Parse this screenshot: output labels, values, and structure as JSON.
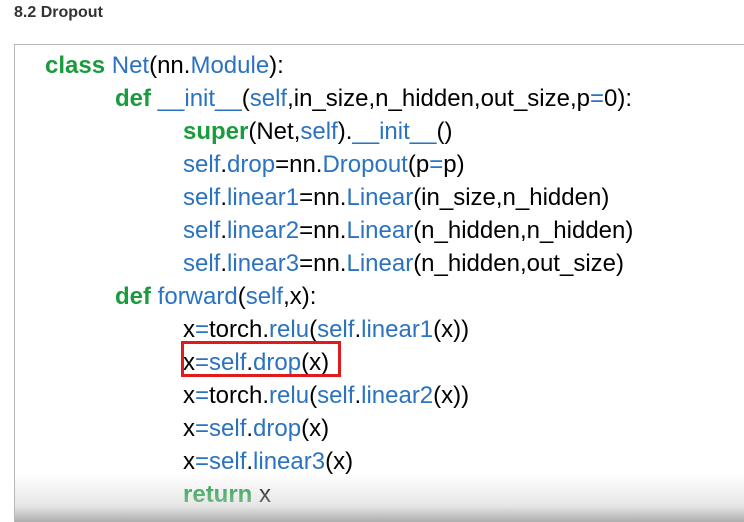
{
  "heading": "8.2 Dropout",
  "colors": {
    "keyword": "#1a9c3e",
    "name": "#2b73c0",
    "plain": "#000000",
    "highlight_box": "#e01b1b",
    "card_border": "#b8b8b8"
  },
  "code": {
    "language": "python",
    "highlighted_line": 10,
    "lines": [
      {
        "indent": 0,
        "tokens": [
          {
            "t": "class ",
            "c": "kw"
          },
          {
            "t": "Net",
            "c": "bl"
          },
          {
            "t": "(nn.",
            "c": "bk"
          },
          {
            "t": "Module",
            "c": "bl"
          },
          {
            "t": "):",
            "c": "bk"
          }
        ]
      },
      {
        "indent": 1,
        "tokens": [
          {
            "t": "def ",
            "c": "kw"
          },
          {
            "t": "__init__",
            "c": "bl"
          },
          {
            "t": "(",
            "c": "bk"
          },
          {
            "t": "self",
            "c": "bl"
          },
          {
            "t": ",in_size,n_hidden,out_size,p",
            "c": "bk"
          },
          {
            "t": "=",
            "c": "bl"
          },
          {
            "t": "0):",
            "c": "bk"
          }
        ]
      },
      {
        "indent": 2,
        "tokens": [
          {
            "t": "super",
            "c": "kw"
          },
          {
            "t": "(Net,",
            "c": "bk"
          },
          {
            "t": "self",
            "c": "bl"
          },
          {
            "t": ").",
            "c": "bk"
          },
          {
            "t": "__init__",
            "c": "bl"
          },
          {
            "t": "()",
            "c": "bk"
          }
        ]
      },
      {
        "indent": 2,
        "tokens": [
          {
            "t": "self",
            "c": "bl"
          },
          {
            "t": ".",
            "c": "bk"
          },
          {
            "t": "drop",
            "c": "bl"
          },
          {
            "t": "=nn.",
            "c": "bk"
          },
          {
            "t": "Dropout",
            "c": "bl"
          },
          {
            "t": "(p",
            "c": "bk"
          },
          {
            "t": "=",
            "c": "bl"
          },
          {
            "t": "p)",
            "c": "bk"
          }
        ]
      },
      {
        "indent": 2,
        "tokens": [
          {
            "t": "self",
            "c": "bl"
          },
          {
            "t": ".",
            "c": "bk"
          },
          {
            "t": "linear1",
            "c": "bl"
          },
          {
            "t": "=nn.",
            "c": "bk"
          },
          {
            "t": "Linear",
            "c": "bl"
          },
          {
            "t": "(in_size,n_hidden)",
            "c": "bk"
          }
        ]
      },
      {
        "indent": 2,
        "tokens": [
          {
            "t": "self",
            "c": "bl"
          },
          {
            "t": ".",
            "c": "bk"
          },
          {
            "t": "linear2",
            "c": "bl"
          },
          {
            "t": "=nn.",
            "c": "bk"
          },
          {
            "t": "Linear",
            "c": "bl"
          },
          {
            "t": "(n_hidden,n_hidden)",
            "c": "bk"
          }
        ]
      },
      {
        "indent": 2,
        "tokens": [
          {
            "t": "self",
            "c": "bl"
          },
          {
            "t": ".",
            "c": "bk"
          },
          {
            "t": "linear3",
            "c": "bl"
          },
          {
            "t": "=nn.",
            "c": "bk"
          },
          {
            "t": "Linear",
            "c": "bl"
          },
          {
            "t": "(n_hidden,out_size)",
            "c": "bk"
          }
        ]
      },
      {
        "indent": 1,
        "tokens": [
          {
            "t": "def ",
            "c": "kw"
          },
          {
            "t": "forward",
            "c": "bl"
          },
          {
            "t": "(",
            "c": "bk"
          },
          {
            "t": "self",
            "c": "bl"
          },
          {
            "t": ",x):",
            "c": "bk"
          }
        ]
      },
      {
        "indent": 2,
        "tokens": [
          {
            "t": "x",
            "c": "bk"
          },
          {
            "t": "=",
            "c": "bl"
          },
          {
            "t": "torch.",
            "c": "bk"
          },
          {
            "t": "relu",
            "c": "bl"
          },
          {
            "t": "(",
            "c": "bk"
          },
          {
            "t": "self",
            "c": "bl"
          },
          {
            "t": ".",
            "c": "bk"
          },
          {
            "t": "linear1",
            "c": "bl"
          },
          {
            "t": "(x))",
            "c": "bk"
          }
        ]
      },
      {
        "indent": 2,
        "tokens": [
          {
            "t": "x",
            "c": "bk"
          },
          {
            "t": "=",
            "c": "bl"
          },
          {
            "t": "self",
            "c": "bl"
          },
          {
            "t": ".",
            "c": "bk"
          },
          {
            "t": "drop",
            "c": "bl"
          },
          {
            "t": "(x)",
            "c": "bk"
          }
        ]
      },
      {
        "indent": 2,
        "tokens": [
          {
            "t": "x",
            "c": "bk"
          },
          {
            "t": "=",
            "c": "bl"
          },
          {
            "t": "torch.",
            "c": "bk"
          },
          {
            "t": "relu",
            "c": "bl"
          },
          {
            "t": "(",
            "c": "bk"
          },
          {
            "t": "self",
            "c": "bl"
          },
          {
            "t": ".",
            "c": "bk"
          },
          {
            "t": "linear2",
            "c": "bl"
          },
          {
            "t": "(x))",
            "c": "bk"
          }
        ]
      },
      {
        "indent": 2,
        "tokens": [
          {
            "t": "x",
            "c": "bk"
          },
          {
            "t": "=",
            "c": "bl"
          },
          {
            "t": "self",
            "c": "bl"
          },
          {
            "t": ".",
            "c": "bk"
          },
          {
            "t": "drop",
            "c": "bl"
          },
          {
            "t": "(x)",
            "c": "bk"
          }
        ]
      },
      {
        "indent": 2,
        "tokens": [
          {
            "t": "x",
            "c": "bk"
          },
          {
            "t": "=",
            "c": "bl"
          },
          {
            "t": "self",
            "c": "bl"
          },
          {
            "t": ".",
            "c": "bk"
          },
          {
            "t": "linear3",
            "c": "bl"
          },
          {
            "t": "(x)",
            "c": "bk"
          }
        ]
      },
      {
        "indent": 2,
        "tokens": [
          {
            "t": "return ",
            "c": "kw"
          },
          {
            "t": "x",
            "c": "bk"
          }
        ]
      }
    ]
  }
}
